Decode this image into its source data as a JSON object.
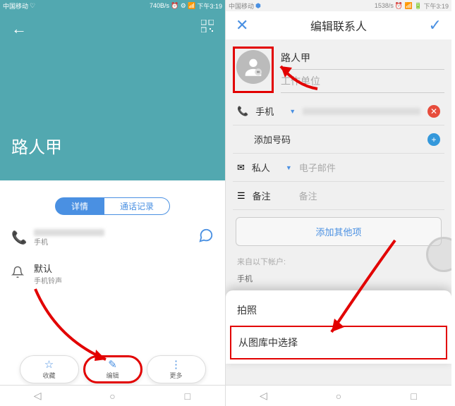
{
  "left": {
    "status": {
      "carrier": "中国移动",
      "speed": "740B/s",
      "time": "下午3:19"
    },
    "contact_name": "路人甲",
    "tabs": {
      "detail": "详情",
      "calllog": "通话记录"
    },
    "phone": {
      "label": "手机",
      "value_masked": true
    },
    "ringtone": {
      "title": "默认",
      "sub": "手机铃声"
    },
    "actions": {
      "favorite": "收藏",
      "edit": "编辑",
      "more": "更多"
    }
  },
  "right": {
    "status": {
      "carrier": "中国移动",
      "speed": "1538/s",
      "time": "下午3:19"
    },
    "title": "编辑联系人",
    "fields": {
      "name": "路人甲",
      "company_placeholder": "工作单位",
      "phone_label": "手机",
      "add_number": "添加号码",
      "private_label": "私人",
      "email_placeholder": "电子邮件",
      "remark_label": "备注",
      "remark_placeholder": "备注"
    },
    "add_other": "添加其他项",
    "account": {
      "from": "来自以下帐户:",
      "type": "手机"
    },
    "sheet": {
      "camera": "拍照",
      "gallery": "从图库中选择"
    }
  }
}
